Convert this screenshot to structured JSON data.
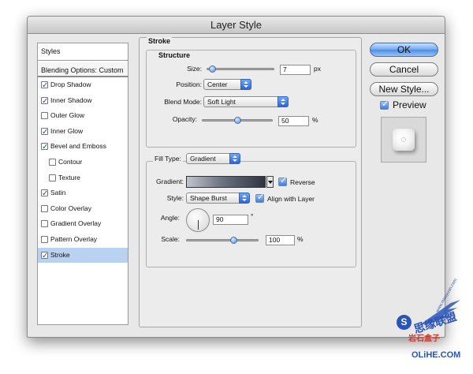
{
  "window": {
    "title": "Layer Style"
  },
  "styles_list": {
    "header": "Styles",
    "blending": "Blending Options: Custom",
    "items": [
      {
        "label": "Drop Shadow",
        "checked": true,
        "sub": false,
        "selected": false
      },
      {
        "label": "Inner Shadow",
        "checked": true,
        "sub": false,
        "selected": false
      },
      {
        "label": "Outer Glow",
        "checked": false,
        "sub": false,
        "selected": false
      },
      {
        "label": "Inner Glow",
        "checked": true,
        "sub": false,
        "selected": false
      },
      {
        "label": "Bevel and Emboss",
        "checked": true,
        "sub": false,
        "selected": false
      },
      {
        "label": "Contour",
        "checked": false,
        "sub": true,
        "selected": false
      },
      {
        "label": "Texture",
        "checked": false,
        "sub": true,
        "selected": false
      },
      {
        "label": "Satin",
        "checked": true,
        "sub": false,
        "selected": false
      },
      {
        "label": "Color Overlay",
        "checked": false,
        "sub": false,
        "selected": false
      },
      {
        "label": "Gradient Overlay",
        "checked": false,
        "sub": false,
        "selected": false
      },
      {
        "label": "Pattern Overlay",
        "checked": false,
        "sub": false,
        "selected": false
      },
      {
        "label": "Stroke",
        "checked": true,
        "sub": false,
        "selected": true
      }
    ]
  },
  "stroke": {
    "title": "Stroke",
    "structure": {
      "title": "Structure",
      "size_label": "Size:",
      "size_value": "7",
      "size_unit": "px",
      "position_label": "Position:",
      "position_value": "Center",
      "blend_label": "Blend Mode:",
      "blend_value": "Soft Light",
      "opacity_label": "Opacity:",
      "opacity_value": "50",
      "opacity_unit": "%"
    },
    "fill": {
      "type_label": "Fill Type:",
      "type_value": "Gradient",
      "gradient_label": "Gradient:",
      "reverse_label": "Reverse",
      "style_label": "Style:",
      "style_value": "Shape Burst",
      "align_label": "Align with Layer",
      "angle_label": "Angle:",
      "angle_value": "90",
      "angle_unit": "°",
      "scale_label": "Scale:",
      "scale_value": "100",
      "scale_unit": "%"
    }
  },
  "buttons": {
    "ok": "OK",
    "cancel": "Cancel",
    "new_style": "New Style...",
    "preview": "Preview"
  },
  "watermark": {
    "logo_letter": "S",
    "cn_top": "思缘联盟",
    "cn_bottom": "岩石盒子",
    "url": "www.missyuan.com",
    "en": "OLiHE.COM"
  }
}
